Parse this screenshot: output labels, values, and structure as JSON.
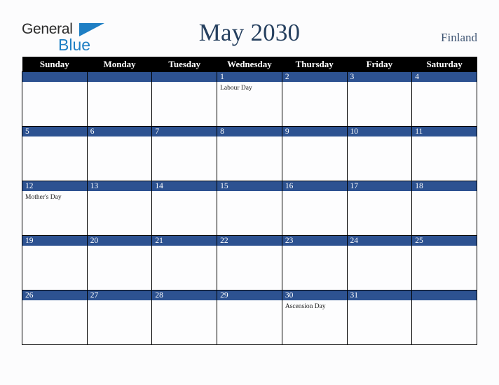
{
  "brand": {
    "name_part1": "General",
    "name_part2": "Blue",
    "triangle_icon": "triangle-icon"
  },
  "header": {
    "title": "May 2030",
    "country": "Finland",
    "title_color": "#26405f",
    "country_color": "#3f5573"
  },
  "colors": {
    "day_bar": "#2d5291",
    "dow_header_bg": "#000000",
    "dow_header_text": "#ffffff",
    "cell_bg": "#fdfdfe",
    "grid_line": "#000000",
    "page_bg": "#fcfcfd",
    "brand_blue": "#1f7fc4",
    "brand_dark": "#2b2b2b"
  },
  "calendar": {
    "month": "May",
    "year": "2030",
    "weekday_headers": [
      "Sunday",
      "Monday",
      "Tuesday",
      "Wednesday",
      "Thursday",
      "Friday",
      "Saturday"
    ],
    "weeks": [
      [
        {
          "date": "",
          "events": []
        },
        {
          "date": "",
          "events": []
        },
        {
          "date": "",
          "events": []
        },
        {
          "date": "1",
          "events": [
            "Labour Day"
          ]
        },
        {
          "date": "2",
          "events": []
        },
        {
          "date": "3",
          "events": []
        },
        {
          "date": "4",
          "events": []
        }
      ],
      [
        {
          "date": "5",
          "events": []
        },
        {
          "date": "6",
          "events": []
        },
        {
          "date": "7",
          "events": []
        },
        {
          "date": "8",
          "events": []
        },
        {
          "date": "9",
          "events": []
        },
        {
          "date": "10",
          "events": []
        },
        {
          "date": "11",
          "events": []
        }
      ],
      [
        {
          "date": "12",
          "events": [
            "Mother's Day"
          ]
        },
        {
          "date": "13",
          "events": []
        },
        {
          "date": "14",
          "events": []
        },
        {
          "date": "15",
          "events": []
        },
        {
          "date": "16",
          "events": []
        },
        {
          "date": "17",
          "events": []
        },
        {
          "date": "18",
          "events": []
        }
      ],
      [
        {
          "date": "19",
          "events": []
        },
        {
          "date": "20",
          "events": []
        },
        {
          "date": "21",
          "events": []
        },
        {
          "date": "22",
          "events": []
        },
        {
          "date": "23",
          "events": []
        },
        {
          "date": "24",
          "events": []
        },
        {
          "date": "25",
          "events": []
        }
      ],
      [
        {
          "date": "26",
          "events": []
        },
        {
          "date": "27",
          "events": []
        },
        {
          "date": "28",
          "events": []
        },
        {
          "date": "29",
          "events": []
        },
        {
          "date": "30",
          "events": [
            "Ascension Day"
          ]
        },
        {
          "date": "31",
          "events": []
        },
        {
          "date": "",
          "events": []
        }
      ]
    ]
  }
}
